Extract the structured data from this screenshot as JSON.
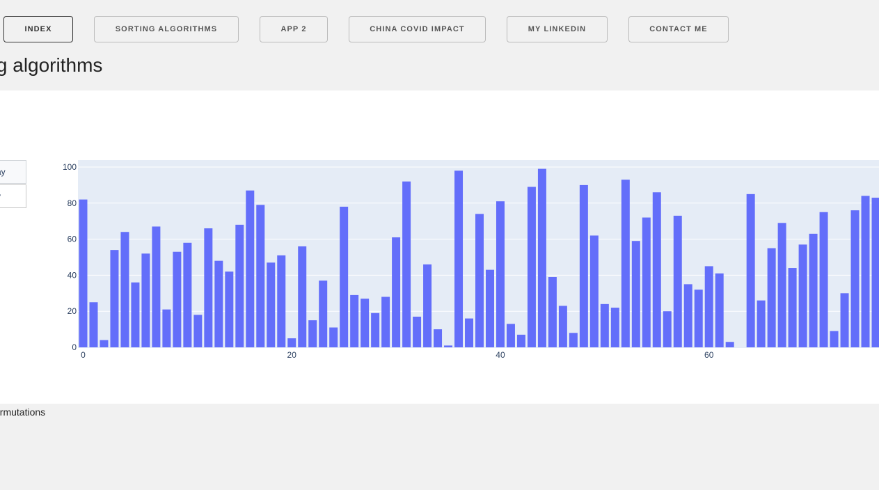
{
  "nav": {
    "buttons": [
      {
        "label": "INDEX",
        "active": true
      },
      {
        "label": "SORTING ALGORITHMS",
        "active": false
      },
      {
        "label": "APP 2",
        "active": false
      },
      {
        "label": "CHINA COVID IMPACT",
        "active": false
      },
      {
        "label": "MY LINKEDIN",
        "active": false
      },
      {
        "label": "CONTACT ME",
        "active": false
      }
    ]
  },
  "page": {
    "title": "rting algorithms",
    "footer_text": "ermutations"
  },
  "controls": {
    "play_label_1": "ay",
    "play_label_2": "play"
  },
  "colors": {
    "bar": "#636efa",
    "plot_bg": "#e5ecf6",
    "grid": "#ffffff",
    "tick_text": "#2a3f5f"
  },
  "chart_data": {
    "type": "bar",
    "title": "",
    "xlabel": "",
    "ylabel": "",
    "ylim": [
      0,
      100
    ],
    "xlim": [
      -0.5,
      76.3
    ],
    "x_ticks": [
      0,
      20,
      40,
      60
    ],
    "y_ticks": [
      0,
      20,
      40,
      60,
      80,
      100
    ],
    "grid": true,
    "legend": "none",
    "x": [
      0,
      1,
      2,
      3,
      4,
      5,
      6,
      7,
      8,
      9,
      10,
      11,
      12,
      13,
      14,
      15,
      16,
      17,
      18,
      19,
      20,
      21,
      22,
      23,
      24,
      25,
      26,
      27,
      28,
      29,
      30,
      31,
      32,
      33,
      34,
      35,
      36,
      37,
      38,
      39,
      40,
      41,
      42,
      43,
      44,
      45,
      46,
      47,
      48,
      49,
      50,
      51,
      52,
      53,
      54,
      55,
      56,
      57,
      58,
      59,
      60,
      61,
      62,
      63,
      64,
      65,
      66,
      67,
      68,
      69,
      70,
      71,
      72,
      73,
      74,
      75,
      76
    ],
    "values": [
      82,
      25,
      4,
      54,
      64,
      36,
      52,
      67,
      21,
      53,
      58,
      18,
      66,
      48,
      42,
      68,
      87,
      79,
      47,
      51,
      5,
      56,
      15,
      37,
      11,
      78,
      29,
      27,
      19,
      28,
      61,
      92,
      17,
      46,
      10,
      1,
      98,
      16,
      74,
      43,
      81,
      13,
      7,
      89,
      99,
      39,
      23,
      8,
      90,
      62,
      24,
      22,
      93,
      59,
      72,
      86,
      20,
      73,
      35,
      32,
      45,
      41,
      3,
      0,
      85,
      26,
      55,
      69,
      44,
      57,
      63,
      75,
      9,
      30,
      76,
      84,
      83
    ]
  }
}
